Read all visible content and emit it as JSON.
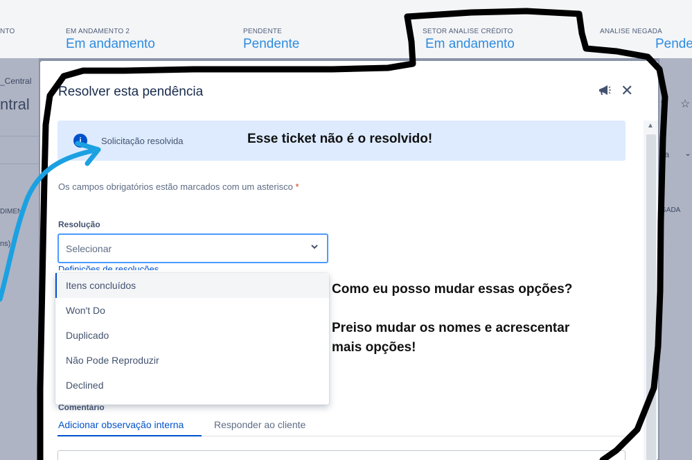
{
  "columns": [
    {
      "label": "NTO",
      "value": ""
    },
    {
      "label": "EM ANDAMENTO 2",
      "value": "Em andamento"
    },
    {
      "label": "PENDENTE",
      "value": "Pendente"
    },
    {
      "label": "SETOR ANALISE CRÉDITO",
      "value": "Em andamento"
    },
    {
      "label": "ANALISE NEGADA",
      "value": "Pende"
    }
  ],
  "left_panel": {
    "t1": "_Central",
    "t2": "ntral",
    "t3": "DIMEN",
    "t4": "ns)"
  },
  "right_panel": {
    "t1": "ta",
    "t2": "GADA"
  },
  "modal": {
    "title": "Resolver esta pendência",
    "banner_text": "Solicitação resolvida",
    "required_note": "Os campos obrigatórios estão marcados com um asterisco",
    "required_star": "*",
    "field_label": "Resolução",
    "select_value": "Selecionar",
    "partial_link": "Definições de resoluções",
    "options": [
      "Itens concluídos",
      "Won't Do",
      "Duplicado",
      "Não Pode Reproduzir",
      "Declined"
    ],
    "comment_label": "Comentário",
    "tabs": [
      "Adicionar observação interna",
      "Responder ao cliente"
    ]
  },
  "annotations": {
    "ticket_note": "Esse ticket não é o resolvido!",
    "question": "Como eu posso mudar essas opções?",
    "request_line1": "Preiso mudar os nomes e acrescentar",
    "request_line2": "mais opções!"
  },
  "icons": {
    "feedback": "megaphone-icon",
    "close": "close-icon",
    "info": "info-icon",
    "chevron": "chevron-down-icon"
  },
  "colors": {
    "accent_blue": "#0052cc",
    "status_value": "#2d8ce0",
    "banner_bg": "#deebff",
    "annotation_arrow": "#1ba1e2",
    "annotation_outline": "#000000"
  }
}
